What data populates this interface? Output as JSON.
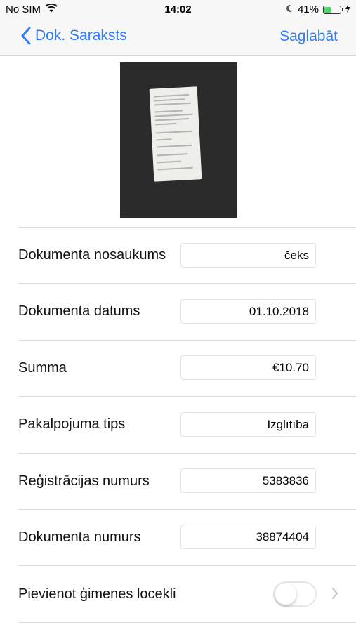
{
  "status_bar": {
    "carrier": "No SIM",
    "time": "14:02",
    "battery_percent": "41%",
    "battery_level": 0.41,
    "icons": [
      "wifi-icon",
      "moon-icon",
      "battery-icon",
      "charging-bolt-icon"
    ]
  },
  "nav": {
    "back_label": "Dok. Saraksts",
    "save_label": "Saglabāt",
    "accent_color": "#2f7cf6"
  },
  "form": {
    "rows": [
      {
        "label": "Dokumenta nosaukums",
        "value": "čeks"
      },
      {
        "label": "Dokumenta datums",
        "value": "01.10.2018"
      },
      {
        "label": "Summa",
        "value": "€10.70"
      },
      {
        "label": "Pakalpojuma tips",
        "value": "Izglītība"
      },
      {
        "label": "Reģistrācijas numurs",
        "value": "5383836"
      },
      {
        "label": "Dokumenta numurs",
        "value": "38874404"
      }
    ],
    "family_member": {
      "label": "Pievienot ģimenes locekli",
      "enabled": false
    }
  }
}
